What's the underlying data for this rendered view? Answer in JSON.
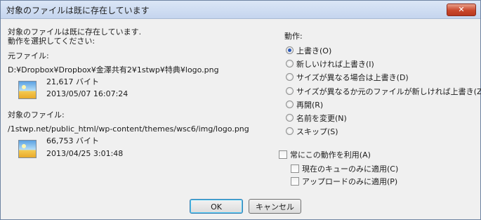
{
  "window": {
    "title": "対象のファイルは既に存在しています",
    "close_label": "✕"
  },
  "message": {
    "line1": "対象のファイルは既に存在しています.",
    "line2": "動作を選択してください:"
  },
  "source": {
    "label": "元ファイル:",
    "path": "D:¥Dropbox¥Dropbox¥金澤共有2¥1stwp¥特典¥logo.png",
    "size": "21,617 バイト",
    "date": "2013/05/07 16:07:24"
  },
  "target": {
    "label": "対象のファイル:",
    "path": "/1stwp.net/public_html/wp-content/themes/wsc6/img/logo.png",
    "size": "66,753 バイト",
    "date": "2013/04/25 3:01:48"
  },
  "action": {
    "heading": "動作:",
    "options": [
      {
        "label": "上書き(O)",
        "selected": true
      },
      {
        "label": "新しいければ上書き(I)",
        "selected": false
      },
      {
        "label": "サイズが異なる場合は上書き(D)",
        "selected": false
      },
      {
        "label": "サイズが異なるか元のファイルが新しければ上書き(Z)",
        "selected": false
      },
      {
        "label": "再開(R)",
        "selected": false
      },
      {
        "label": "名前を変更(N)",
        "selected": false
      },
      {
        "label": "スキップ(S)",
        "selected": false
      }
    ]
  },
  "checkboxes": {
    "always": "常にこの動作を利用(A)",
    "queue_only": "現在のキューのみに適用(C)",
    "upload_only": "アップロードのみに適用(P)"
  },
  "buttons": {
    "ok": "OK",
    "cancel": "キャンセル"
  }
}
